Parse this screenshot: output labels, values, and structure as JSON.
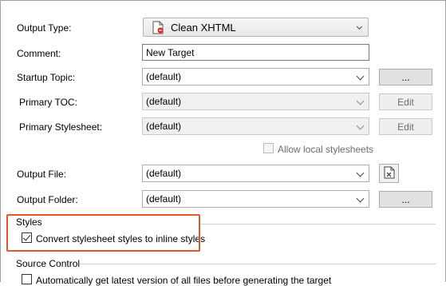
{
  "output_type": {
    "label": "Output Type:",
    "value": "Clean XHTML",
    "icon": "xhtml-doc-icon"
  },
  "comment": {
    "label": "Comment:",
    "value": "New Target"
  },
  "startup_topic": {
    "label": "Startup Topic:",
    "value": "(default)",
    "browse_label": "..."
  },
  "primary_toc": {
    "label": "Primary TOC:",
    "value": "(default)",
    "edit_label": "Edit"
  },
  "primary_stylesheet": {
    "label": "Primary Stylesheet:",
    "value": "(default)",
    "edit_label": "Edit"
  },
  "allow_local": {
    "label": "Allow local stylesheets",
    "checked": false,
    "enabled": false
  },
  "output_file": {
    "label": "Output File:",
    "value": "(default)",
    "icon": "xhtml-file-icon"
  },
  "output_folder": {
    "label": "Output Folder:",
    "value": "(default)",
    "browse_label": "..."
  },
  "styles": {
    "title": "Styles",
    "convert_label": "Convert stylesheet styles to inline styles",
    "checked": true
  },
  "source_control": {
    "title": "Source Control",
    "auto_get_label": "Automatically get latest version of all files before generating the target",
    "checked": false
  },
  "colors": {
    "highlight": "#e2572b"
  }
}
